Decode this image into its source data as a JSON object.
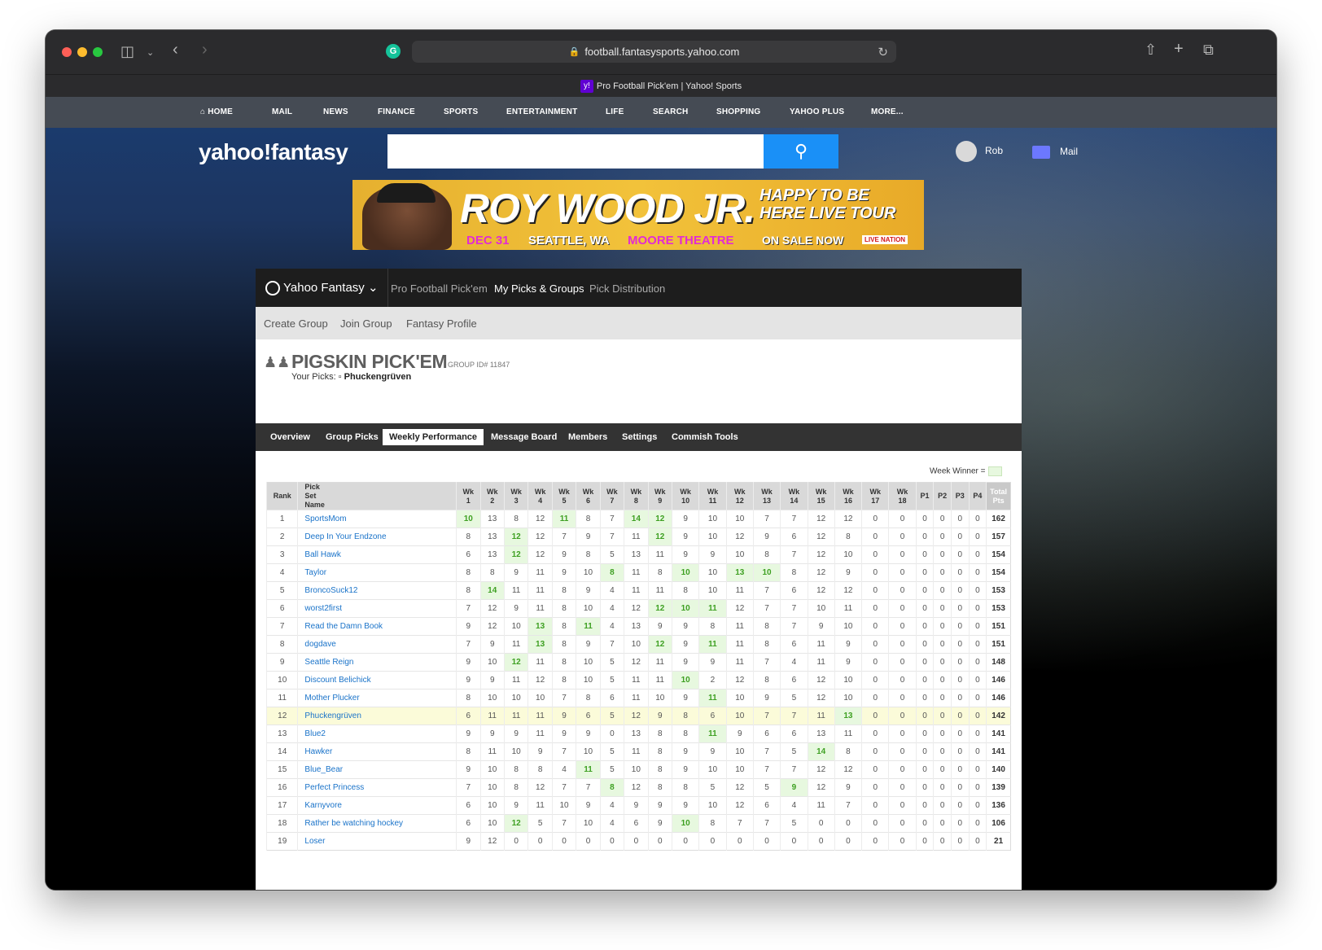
{
  "browser": {
    "url": "football.fantasysports.yahoo.com",
    "tab_title": "Pro Football Pick'em | Yahoo! Sports"
  },
  "yahoo_nav": [
    "HOME",
    "MAIL",
    "NEWS",
    "FINANCE",
    "SPORTS",
    "ENTERTAINMENT",
    "LIFE",
    "SEARCH",
    "SHOPPING",
    "YAHOO PLUS",
    "MORE..."
  ],
  "header": {
    "logo": "yahoo!fantasy",
    "user_name": "Rob",
    "mail_label": "Mail"
  },
  "ad": {
    "headline": "ROY WOOD JR.",
    "tour": "HAPPY TO BE HERE LIVE TOUR",
    "date": "DEC 31",
    "city": "SEATTLE, WA",
    "venue": "MOORE THEATRE",
    "sale": "ON SALE NOW",
    "sponsor": "LIVE NATION"
  },
  "fantasy_nav": {
    "brand": "Yahoo Fantasy",
    "links": [
      "Pro Football Pick'em",
      "My Picks & Groups",
      "Pick Distribution"
    ]
  },
  "subnav": [
    "Create Group",
    "Join Group",
    "Fantasy Profile"
  ],
  "group": {
    "name": "PIGSKIN PICK'EM",
    "id_label": "GROUP ID# 11847",
    "your_picks_label": "Your Picks:",
    "your_picks_name": "Phuckengrüven"
  },
  "tabs": [
    "Overview",
    "Group Picks",
    "Weekly Performance",
    "Message Board",
    "Members",
    "Settings",
    "Commish Tools"
  ],
  "active_tab": "Weekly Performance",
  "week_winner_label": "Week Winner =",
  "colors": {
    "winner_bg": "#e7f8df",
    "winner_text": "#3ea022",
    "my_row_bg": "#fbfbd9",
    "link": "#1a73c9"
  },
  "table": {
    "headers": {
      "rank": "Rank",
      "name": "Pick Set Name",
      "weeks": [
        "Wk 1",
        "Wk 2",
        "Wk 3",
        "Wk 4",
        "Wk 5",
        "Wk 6",
        "Wk 7",
        "Wk 8",
        "Wk 9",
        "Wk 10",
        "Wk 11",
        "Wk 12",
        "Wk 13",
        "Wk 14",
        "Wk 15",
        "Wk 16",
        "Wk 17",
        "Wk 18"
      ],
      "playoffs": [
        "P1",
        "P2",
        "P3",
        "P4"
      ],
      "total": "Total Pts"
    },
    "rows": [
      {
        "rank": "1",
        "name": "SportsMom",
        "weeks": [
          10,
          13,
          8,
          12,
          11,
          8,
          7,
          14,
          12,
          9,
          10,
          10,
          7,
          7,
          12,
          12,
          0,
          0
        ],
        "playoffs": [
          0,
          0,
          0,
          0
        ],
        "total": 162,
        "winners": [
          1,
          5,
          8,
          9
        ]
      },
      {
        "rank": "2",
        "name": "Deep In Your Endzone",
        "weeks": [
          8,
          13,
          12,
          12,
          7,
          9,
          7,
          11,
          12,
          9,
          10,
          12,
          9,
          6,
          12,
          8,
          0,
          0
        ],
        "playoffs": [
          0,
          0,
          0,
          0
        ],
        "total": 157,
        "winners": [
          3,
          9
        ]
      },
      {
        "rank": "3",
        "name": "Ball Hawk",
        "weeks": [
          6,
          13,
          12,
          12,
          9,
          8,
          5,
          13,
          11,
          9,
          9,
          10,
          8,
          7,
          12,
          10,
          0,
          0
        ],
        "playoffs": [
          0,
          0,
          0,
          0
        ],
        "total": 154,
        "winners": [
          3
        ]
      },
      {
        "rank": "4",
        "name": "Taylor",
        "weeks": [
          8,
          8,
          9,
          11,
          9,
          10,
          8,
          11,
          8,
          10,
          10,
          13,
          10,
          8,
          12,
          9,
          0,
          0
        ],
        "playoffs": [
          0,
          0,
          0,
          0
        ],
        "total": 154,
        "winners": [
          7,
          10,
          12,
          13
        ]
      },
      {
        "rank": "5",
        "name": "BroncoSuck12",
        "weeks": [
          8,
          14,
          11,
          11,
          8,
          9,
          4,
          11,
          11,
          8,
          10,
          11,
          7,
          6,
          12,
          12,
          0,
          0
        ],
        "playoffs": [
          0,
          0,
          0,
          0
        ],
        "total": 153,
        "winners": [
          2
        ]
      },
      {
        "rank": "6",
        "name": "worst2first",
        "weeks": [
          7,
          12,
          9,
          11,
          8,
          10,
          4,
          12,
          12,
          10,
          11,
          12,
          7,
          7,
          10,
          11,
          0,
          0
        ],
        "playoffs": [
          0,
          0,
          0,
          0
        ],
        "total": 153,
        "winners": [
          9,
          10,
          11
        ]
      },
      {
        "rank": "7",
        "name": "Read the Damn Book",
        "weeks": [
          9,
          12,
          10,
          13,
          8,
          11,
          4,
          13,
          9,
          9,
          8,
          11,
          8,
          7,
          9,
          10,
          0,
          0
        ],
        "playoffs": [
          0,
          0,
          0,
          0
        ],
        "total": 151,
        "winners": [
          4,
          6
        ]
      },
      {
        "rank": "8",
        "name": "dogdave",
        "weeks": [
          7,
          9,
          11,
          13,
          8,
          9,
          7,
          10,
          12,
          9,
          11,
          11,
          8,
          6,
          11,
          9,
          0,
          0
        ],
        "playoffs": [
          0,
          0,
          0,
          0
        ],
        "total": 151,
        "winners": [
          4,
          9,
          11
        ]
      },
      {
        "rank": "9",
        "name": "Seattle Reign",
        "weeks": [
          9,
          10,
          12,
          11,
          8,
          10,
          5,
          12,
          11,
          9,
          9,
          11,
          7,
          4,
          11,
          9,
          0,
          0
        ],
        "playoffs": [
          0,
          0,
          0,
          0
        ],
        "total": 148,
        "winners": [
          3
        ]
      },
      {
        "rank": "10",
        "name": "Discount Belichick",
        "weeks": [
          9,
          9,
          11,
          12,
          8,
          10,
          5,
          11,
          11,
          10,
          2,
          12,
          8,
          6,
          12,
          10,
          0,
          0
        ],
        "playoffs": [
          0,
          0,
          0,
          0
        ],
        "total": 146,
        "winners": [
          10
        ]
      },
      {
        "rank": "11",
        "name": "Mother Plucker",
        "weeks": [
          8,
          10,
          10,
          10,
          7,
          8,
          6,
          11,
          10,
          9,
          11,
          10,
          9,
          5,
          12,
          10,
          0,
          0
        ],
        "playoffs": [
          0,
          0,
          0,
          0
        ],
        "total": 146,
        "winners": [
          11
        ]
      },
      {
        "rank": "12",
        "name": "Phuckengrüven",
        "weeks": [
          6,
          11,
          11,
          11,
          9,
          6,
          5,
          12,
          9,
          8,
          6,
          10,
          7,
          7,
          11,
          13,
          0,
          0
        ],
        "playoffs": [
          0,
          0,
          0,
          0
        ],
        "total": 142,
        "winners": [
          16
        ],
        "me": true
      },
      {
        "rank": "13",
        "name": "Blue2",
        "weeks": [
          9,
          9,
          9,
          11,
          9,
          9,
          0,
          13,
          8,
          8,
          11,
          9,
          6,
          6,
          13,
          11,
          0,
          0
        ],
        "playoffs": [
          0,
          0,
          0,
          0
        ],
        "total": 141,
        "winners": [
          11
        ]
      },
      {
        "rank": "14",
        "name": "Hawker",
        "weeks": [
          8,
          11,
          10,
          9,
          7,
          10,
          5,
          11,
          8,
          9,
          9,
          10,
          7,
          5,
          14,
          8,
          0,
          0
        ],
        "playoffs": [
          0,
          0,
          0,
          0
        ],
        "total": 141,
        "winners": [
          15
        ]
      },
      {
        "rank": "15",
        "name": "Blue_Bear",
        "weeks": [
          9,
          10,
          8,
          8,
          4,
          11,
          5,
          10,
          8,
          9,
          10,
          10,
          7,
          7,
          12,
          12,
          0,
          0
        ],
        "playoffs": [
          0,
          0,
          0,
          0
        ],
        "total": 140,
        "winners": [
          6
        ]
      },
      {
        "rank": "16",
        "name": "Perfect Princess",
        "weeks": [
          7,
          10,
          8,
          12,
          7,
          7,
          8,
          12,
          8,
          8,
          5,
          12,
          5,
          9,
          12,
          9,
          0,
          0
        ],
        "playoffs": [
          0,
          0,
          0,
          0
        ],
        "total": 139,
        "winners": [
          7,
          14
        ]
      },
      {
        "rank": "17",
        "name": "Karnyvore",
        "weeks": [
          6,
          10,
          9,
          11,
          10,
          9,
          4,
          9,
          9,
          9,
          10,
          12,
          6,
          4,
          11,
          7,
          0,
          0
        ],
        "playoffs": [
          0,
          0,
          0,
          0
        ],
        "total": 136,
        "winners": []
      },
      {
        "rank": "18",
        "name": "Rather be watching hockey",
        "weeks": [
          6,
          10,
          12,
          5,
          7,
          10,
          4,
          6,
          9,
          10,
          8,
          7,
          7,
          5,
          0,
          0,
          0,
          0
        ],
        "playoffs": [
          0,
          0,
          0,
          0
        ],
        "total": 106,
        "winners": [
          3,
          10
        ]
      },
      {
        "rank": "19",
        "name": "Loser",
        "weeks": [
          9,
          12,
          0,
          0,
          0,
          0,
          0,
          0,
          0,
          0,
          0,
          0,
          0,
          0,
          0,
          0,
          0,
          0
        ],
        "playoffs": [
          0,
          0,
          0,
          0
        ],
        "total": 21,
        "winners": []
      }
    ]
  }
}
